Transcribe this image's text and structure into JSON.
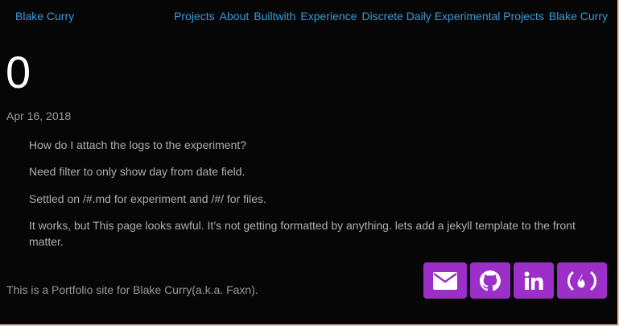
{
  "header": {
    "brand": "Blake Curry",
    "nav": [
      "Projects",
      "About",
      "Builtwith",
      "Experience",
      "Discrete Daily Experimental Projects",
      "Blake Curry"
    ]
  },
  "post": {
    "title": "0",
    "date": "Apr 16, 2018",
    "paragraphs": [
      "How do I attach the logs to the experiment?",
      "Need filter to only show day from date field.",
      "Settled on /#.md for experiment and /#/ for files.",
      "It works, but This page looks awful. It’s not getting formatted by anything. lets add a jekyll template to the front matter."
    ]
  },
  "footer": {
    "text": "This is a Portfolio site for Blake Curry(a.k.a. Faxn).",
    "social_icons": [
      "email-icon",
      "github-icon",
      "linkedin-icon",
      "freecodecamp-icon"
    ]
  },
  "colors": {
    "background": "#060607",
    "link": "#3a9bd8",
    "social_button": "#9b2fc8",
    "body_text": "#aeaeae"
  }
}
